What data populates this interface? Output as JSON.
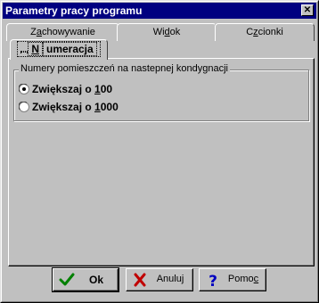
{
  "window": {
    "title": "Parametry pracy programu",
    "close_glyph": "✕"
  },
  "tabs": {
    "zachowywanie": {
      "pre": "Z",
      "underline": "a",
      "post": "chowywanie"
    },
    "widok": {
      "pre": "Wi",
      "underline": "d",
      "post": "ok"
    },
    "czcionki": {
      "pre": "C",
      "underline": "z",
      "post": "cionki"
    },
    "numeracja": {
      "pre": "",
      "underline": "N",
      "post": "umeracja"
    }
  },
  "group": {
    "legend": "Numery pomieszczeń na nastepnej kondygnacji",
    "options": [
      {
        "pre": "Zwiększaj o ",
        "underline": "1",
        "post": "00",
        "selected": true
      },
      {
        "pre": "Zwiększaj o ",
        "underline": "1",
        "post": "000",
        "selected": false
      }
    ]
  },
  "buttons": {
    "ok": {
      "label": "Ok",
      "icon": "checkmark-icon"
    },
    "anuluj": {
      "pre": "Anulu",
      "underline": "j",
      "post": "",
      "icon": "cross-icon"
    },
    "pomoc": {
      "pre": "Pomo",
      "underline": "c",
      "post": "",
      "icon": "question-icon"
    }
  },
  "colors": {
    "titlebar": "#000080",
    "face": "#c0c0c0",
    "check": "#008000",
    "cross": "#c00000",
    "question": "#0000c0"
  }
}
